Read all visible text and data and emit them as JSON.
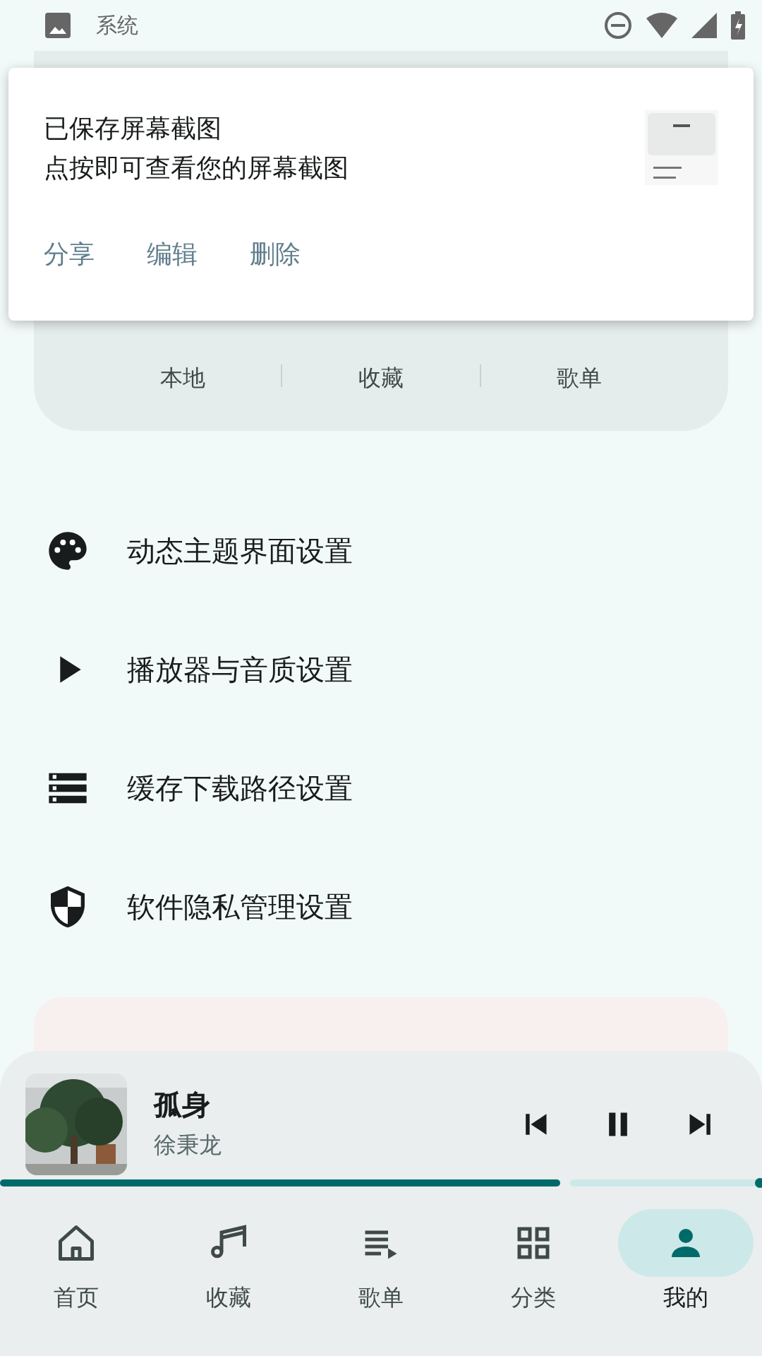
{
  "status_bar": {
    "app_label": "系统"
  },
  "notification": {
    "title": "已保存屏幕截图",
    "text": "点按即可查看您的屏幕截图",
    "actions": [
      "分享",
      "编辑",
      "删除"
    ]
  },
  "profile_card": {
    "stats": [
      {
        "label": "本地"
      },
      {
        "label": "收藏"
      },
      {
        "label": "歌单"
      }
    ]
  },
  "settings": [
    {
      "label": "动态主题界面设置"
    },
    {
      "label": "播放器与音质设置"
    },
    {
      "label": "缓存下载路径设置"
    },
    {
      "label": "软件隐私管理设置"
    }
  ],
  "player": {
    "title": "孤身",
    "artist": "徐秉龙",
    "playing": true,
    "level": 0.735
  },
  "nav": [
    {
      "label": "首页",
      "selected": false
    },
    {
      "label": "收藏",
      "selected": false
    },
    {
      "label": "歌单",
      "selected": false
    },
    {
      "label": "分类",
      "selected": false
    },
    {
      "label": "我的",
      "selected": true
    }
  ]
}
